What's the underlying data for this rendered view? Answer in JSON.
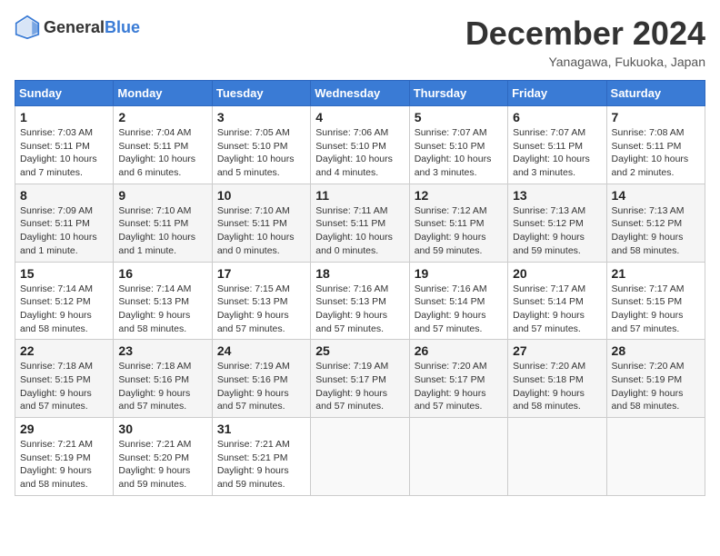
{
  "header": {
    "logo_general": "General",
    "logo_blue": "Blue",
    "title": "December 2024",
    "location": "Yanagawa, Fukuoka, Japan"
  },
  "weekdays": [
    "Sunday",
    "Monday",
    "Tuesday",
    "Wednesday",
    "Thursday",
    "Friday",
    "Saturday"
  ],
  "weeks": [
    [
      {
        "day": "1",
        "sunrise": "7:03 AM",
        "sunset": "5:11 PM",
        "daylight": "10 hours and 7 minutes."
      },
      {
        "day": "2",
        "sunrise": "7:04 AM",
        "sunset": "5:11 PM",
        "daylight": "10 hours and 6 minutes."
      },
      {
        "day": "3",
        "sunrise": "7:05 AM",
        "sunset": "5:10 PM",
        "daylight": "10 hours and 5 minutes."
      },
      {
        "day": "4",
        "sunrise": "7:06 AM",
        "sunset": "5:10 PM",
        "daylight": "10 hours and 4 minutes."
      },
      {
        "day": "5",
        "sunrise": "7:07 AM",
        "sunset": "5:10 PM",
        "daylight": "10 hours and 3 minutes."
      },
      {
        "day": "6",
        "sunrise": "7:07 AM",
        "sunset": "5:11 PM",
        "daylight": "10 hours and 3 minutes."
      },
      {
        "day": "7",
        "sunrise": "7:08 AM",
        "sunset": "5:11 PM",
        "daylight": "10 hours and 2 minutes."
      }
    ],
    [
      {
        "day": "8",
        "sunrise": "7:09 AM",
        "sunset": "5:11 PM",
        "daylight": "10 hours and 1 minute."
      },
      {
        "day": "9",
        "sunrise": "7:10 AM",
        "sunset": "5:11 PM",
        "daylight": "10 hours and 1 minute."
      },
      {
        "day": "10",
        "sunrise": "7:10 AM",
        "sunset": "5:11 PM",
        "daylight": "10 hours and 0 minutes."
      },
      {
        "day": "11",
        "sunrise": "7:11 AM",
        "sunset": "5:11 PM",
        "daylight": "10 hours and 0 minutes."
      },
      {
        "day": "12",
        "sunrise": "7:12 AM",
        "sunset": "5:11 PM",
        "daylight": "9 hours and 59 minutes."
      },
      {
        "day": "13",
        "sunrise": "7:13 AM",
        "sunset": "5:12 PM",
        "daylight": "9 hours and 59 minutes."
      },
      {
        "day": "14",
        "sunrise": "7:13 AM",
        "sunset": "5:12 PM",
        "daylight": "9 hours and 58 minutes."
      }
    ],
    [
      {
        "day": "15",
        "sunrise": "7:14 AM",
        "sunset": "5:12 PM",
        "daylight": "9 hours and 58 minutes."
      },
      {
        "day": "16",
        "sunrise": "7:14 AM",
        "sunset": "5:13 PM",
        "daylight": "9 hours and 58 minutes."
      },
      {
        "day": "17",
        "sunrise": "7:15 AM",
        "sunset": "5:13 PM",
        "daylight": "9 hours and 57 minutes."
      },
      {
        "day": "18",
        "sunrise": "7:16 AM",
        "sunset": "5:13 PM",
        "daylight": "9 hours and 57 minutes."
      },
      {
        "day": "19",
        "sunrise": "7:16 AM",
        "sunset": "5:14 PM",
        "daylight": "9 hours and 57 minutes."
      },
      {
        "day": "20",
        "sunrise": "7:17 AM",
        "sunset": "5:14 PM",
        "daylight": "9 hours and 57 minutes."
      },
      {
        "day": "21",
        "sunrise": "7:17 AM",
        "sunset": "5:15 PM",
        "daylight": "9 hours and 57 minutes."
      }
    ],
    [
      {
        "day": "22",
        "sunrise": "7:18 AM",
        "sunset": "5:15 PM",
        "daylight": "9 hours and 57 minutes."
      },
      {
        "day": "23",
        "sunrise": "7:18 AM",
        "sunset": "5:16 PM",
        "daylight": "9 hours and 57 minutes."
      },
      {
        "day": "24",
        "sunrise": "7:19 AM",
        "sunset": "5:16 PM",
        "daylight": "9 hours and 57 minutes."
      },
      {
        "day": "25",
        "sunrise": "7:19 AM",
        "sunset": "5:17 PM",
        "daylight": "9 hours and 57 minutes."
      },
      {
        "day": "26",
        "sunrise": "7:20 AM",
        "sunset": "5:17 PM",
        "daylight": "9 hours and 57 minutes."
      },
      {
        "day": "27",
        "sunrise": "7:20 AM",
        "sunset": "5:18 PM",
        "daylight": "9 hours and 58 minutes."
      },
      {
        "day": "28",
        "sunrise": "7:20 AM",
        "sunset": "5:19 PM",
        "daylight": "9 hours and 58 minutes."
      }
    ],
    [
      {
        "day": "29",
        "sunrise": "7:21 AM",
        "sunset": "5:19 PM",
        "daylight": "9 hours and 58 minutes."
      },
      {
        "day": "30",
        "sunrise": "7:21 AM",
        "sunset": "5:20 PM",
        "daylight": "9 hours and 59 minutes."
      },
      {
        "day": "31",
        "sunrise": "7:21 AM",
        "sunset": "5:21 PM",
        "daylight": "9 hours and 59 minutes."
      },
      null,
      null,
      null,
      null
    ]
  ]
}
